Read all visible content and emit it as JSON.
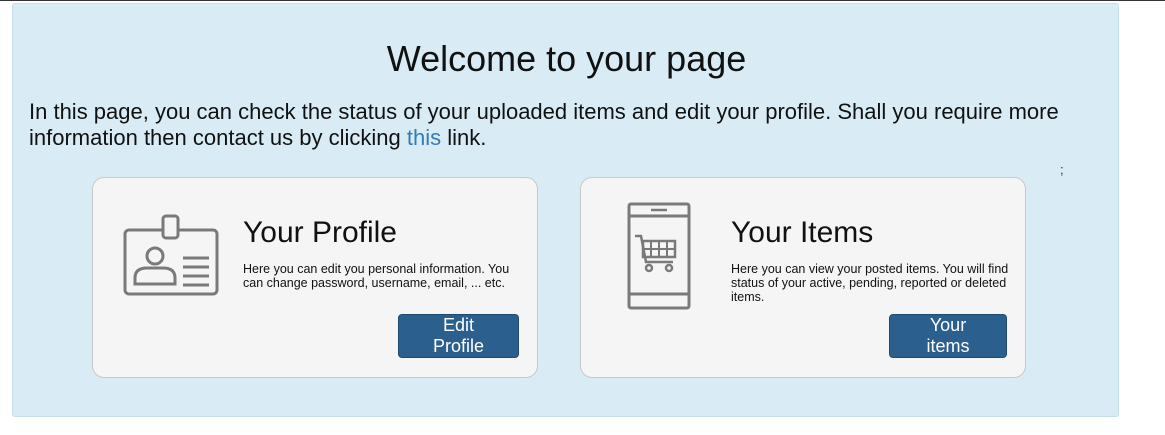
{
  "welcome": {
    "title": "Welcome to your page",
    "intro_before": "In this page, you can check the status of your uploaded items and edit your profile. Shall you require more information then contact us by clicking ",
    "intro_link": "this",
    "intro_after": " link.",
    "stray_mark": ";"
  },
  "cards": {
    "profile": {
      "icon": "id-badge-icon",
      "title": "Your Profile",
      "description": "Here you can edit you personal information. You can change password, username, email, ... etc.",
      "button_label": "Edit Profile"
    },
    "items": {
      "icon": "mobile-cart-icon",
      "title": "Your Items",
      "description": "Here you can view your posted items. You will find status of your active, pending, reported or deleted items.",
      "button_label": "Your items"
    }
  },
  "colors": {
    "jumbotron_bg": "#d9ecf5",
    "card_bg": "#f5f5f5",
    "button_bg": "#2b5f8e",
    "link": "#337ab7"
  }
}
